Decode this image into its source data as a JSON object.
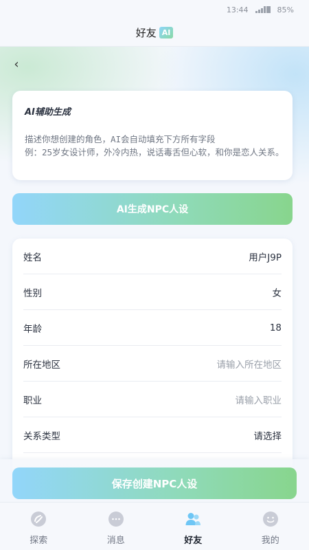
{
  "status_bar": {
    "time": "13:44",
    "battery": "85%"
  },
  "header": {
    "title": "好友",
    "badge": "AI"
  },
  "nav": {
    "back_icon": "‹"
  },
  "ai_card": {
    "title": "AI辅助生成",
    "description_line1": "描述你想创建的角色，AI会自动填充下方所有字段",
    "description_line2": "例：25岁女设计师，外冷内热，说话毒舌但心软，和你是恋人关系。"
  },
  "generate_button": {
    "label": "AI生成NPC人设"
  },
  "form": {
    "rows": [
      {
        "label": "姓名",
        "value": "用户J9P",
        "is_placeholder": false
      },
      {
        "label": "性别",
        "value": "女",
        "is_placeholder": false
      },
      {
        "label": "年龄",
        "value": "18",
        "is_placeholder": false
      },
      {
        "label": "所在地区",
        "value": "请输入所在地区",
        "is_placeholder": true
      },
      {
        "label": "职业",
        "value": "请输入职业",
        "is_placeholder": true
      },
      {
        "label": "关系类型",
        "value": "请选择",
        "is_placeholder": false
      }
    ]
  },
  "save_button": {
    "label": "保存创建NPC人设"
  },
  "tabs": [
    {
      "label": "探索",
      "icon": "explore-icon",
      "active": false
    },
    {
      "label": "消息",
      "icon": "message-icon",
      "active": false
    },
    {
      "label": "好友",
      "icon": "friends-icon",
      "active": true
    },
    {
      "label": "我的",
      "icon": "profile-icon",
      "active": false
    }
  ],
  "colors": {
    "accent_start": "#92d6fa",
    "accent_end": "#88d58d",
    "active_tab_icon": "#6ec6f5",
    "inactive_tab_icon": "#c9ccd6"
  }
}
